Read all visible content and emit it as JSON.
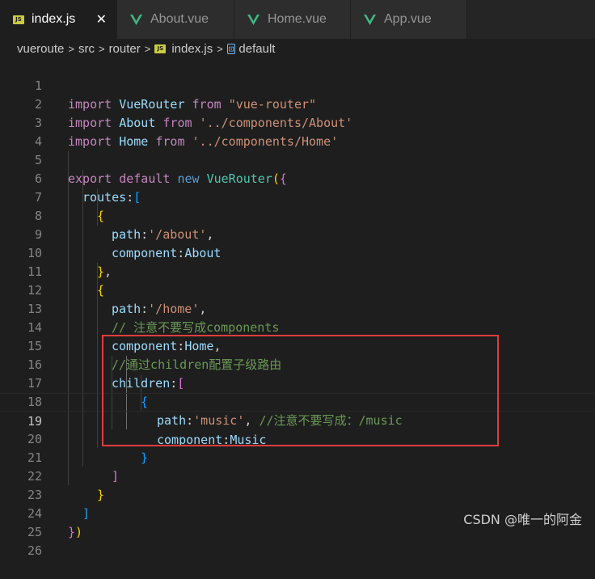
{
  "tabs": [
    {
      "label": "index.js",
      "icon": "js-icon",
      "active": true
    },
    {
      "label": "About.vue",
      "icon": "vue-icon",
      "active": false
    },
    {
      "label": "Home.vue",
      "icon": "vue-icon",
      "active": false
    },
    {
      "label": "App.vue",
      "icon": "vue-icon",
      "active": false
    }
  ],
  "tab_close": "✕",
  "breadcrumb": {
    "items": [
      "vueroute",
      "src",
      "router",
      "index.js",
      "default"
    ],
    "separator": ">",
    "js_badge": "JS",
    "symbol_badge": "⊡"
  },
  "code_lines": [
    {
      "n": "1"
    },
    {
      "n": "2"
    },
    {
      "n": "3"
    },
    {
      "n": "4"
    },
    {
      "n": "5"
    },
    {
      "n": "6"
    },
    {
      "n": "7"
    },
    {
      "n": "8"
    },
    {
      "n": "9"
    },
    {
      "n": "10"
    },
    {
      "n": "11"
    },
    {
      "n": "12"
    },
    {
      "n": "13"
    },
    {
      "n": "14"
    },
    {
      "n": "15"
    },
    {
      "n": "16"
    },
    {
      "n": "17"
    },
    {
      "n": "18"
    },
    {
      "n": "19"
    },
    {
      "n": "20"
    },
    {
      "n": "21"
    },
    {
      "n": "22"
    },
    {
      "n": "23"
    },
    {
      "n": "24"
    },
    {
      "n": "25"
    },
    {
      "n": "26"
    }
  ],
  "code": {
    "l1": {
      "t1": "import",
      "t2": " VueRouter ",
      "t3": "from",
      "t4": " ",
      "t5": "\"vue-router\""
    },
    "l2": {
      "t1": "import",
      "t2": " About ",
      "t3": "from",
      "t4": " ",
      "t5": "'../components/About'"
    },
    "l3": {
      "t1": "import",
      "t2": " Home ",
      "t3": "from",
      "t4": " ",
      "t5": "'../components/Home'"
    },
    "l5": {
      "t1": "export",
      "t2": " ",
      "t3": "default",
      "t4": " ",
      "t5": "new",
      "t6": " ",
      "t7": "VueRouter",
      "t8": "(",
      "t9": "{"
    },
    "l6": {
      "t1": "routes",
      "t2": ":",
      "t3": "["
    },
    "l7": {
      "t1": "{"
    },
    "l8": {
      "t1": "path",
      "t2": ":",
      "t3": "'/about'",
      "t4": ","
    },
    "l9": {
      "t1": "component",
      "t2": ":",
      "t3": "About"
    },
    "l10": {
      "t1": "}",
      "t2": ","
    },
    "l11": {
      "t1": "{"
    },
    "l12": {
      "t1": "path",
      "t2": ":",
      "t3": "'/home'",
      "t4": ","
    },
    "l13": {
      "t1": "// 注意不要写成components"
    },
    "l14": {
      "t1": "component",
      "t2": ":",
      "t3": "Home",
      "t4": ","
    },
    "l15": {
      "t1": "//通过children配置子级路由"
    },
    "l16": {
      "t1": "children",
      "t2": ":",
      "t3": "["
    },
    "l17": {
      "t1": "{"
    },
    "l18": {
      "t1": "path",
      "t2": ":",
      "t3": "'music'",
      "t4": ", ",
      "t5": "//注意不要写成：/music"
    },
    "l19": {
      "t1": "component",
      "t2": ":",
      "t3": "Music"
    },
    "l20": {
      "t1": "}"
    },
    "l21": {
      "t1": "]"
    },
    "l22": {
      "t1": "}"
    },
    "l23": {
      "t1": "]"
    },
    "l24": {
      "t1": "}",
      "t2": ")"
    }
  },
  "current_line": "19",
  "watermark": "CSDN @唯一的阿金",
  "colors": {
    "background": "#1e1e1e",
    "highlight_box": "#e03c3c",
    "keyword": "#c586c0",
    "string": "#ce9178",
    "comment": "#6a9955"
  }
}
